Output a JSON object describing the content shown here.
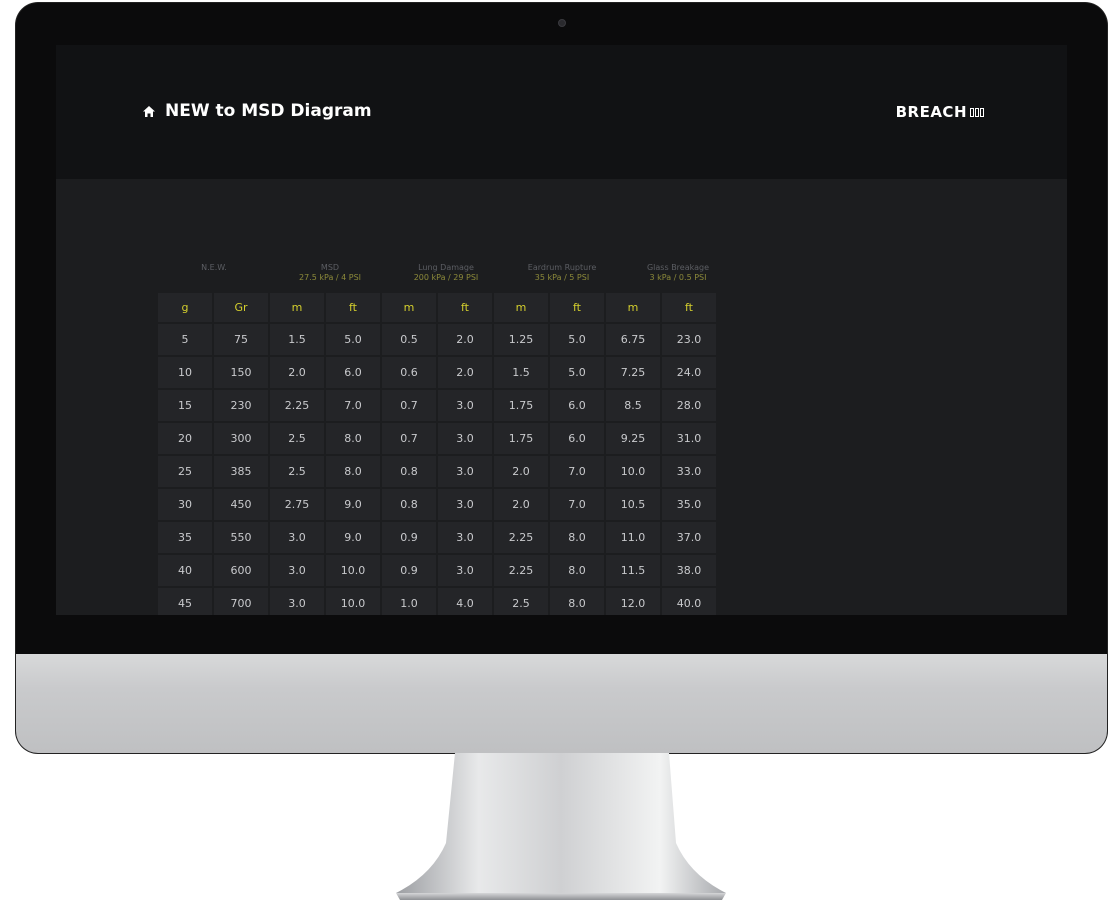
{
  "header": {
    "title": "NEW to MSD Diagram",
    "brand": "BREACH"
  },
  "groups": [
    {
      "label": "N.E.W.",
      "sub": ""
    },
    {
      "label": "MSD",
      "sub": "27.5 kPa / 4 PSI"
    },
    {
      "label": "Lung Damage",
      "sub": "200 kPa / 29 PSI"
    },
    {
      "label": "Eardrum Rupture",
      "sub": "35 kPa / 5 PSI"
    },
    {
      "label": "Glass Breakage",
      "sub": "3 kPa / 0.5 PSI"
    }
  ],
  "units": [
    "g",
    "Gr",
    "m",
    "ft",
    "m",
    "ft",
    "m",
    "ft",
    "m",
    "ft"
  ],
  "rows": [
    [
      "5",
      "75",
      "1.5",
      "5.0",
      "0.5",
      "2.0",
      "1.25",
      "5.0",
      "6.75",
      "23.0"
    ],
    [
      "10",
      "150",
      "2.0",
      "6.0",
      "0.6",
      "2.0",
      "1.5",
      "5.0",
      "7.25",
      "24.0"
    ],
    [
      "15",
      "230",
      "2.25",
      "7.0",
      "0.7",
      "3.0",
      "1.75",
      "6.0",
      "8.5",
      "28.0"
    ],
    [
      "20",
      "300",
      "2.5",
      "8.0",
      "0.7",
      "3.0",
      "1.75",
      "6.0",
      "9.25",
      "31.0"
    ],
    [
      "25",
      "385",
      "2.5",
      "8.0",
      "0.8",
      "3.0",
      "2.0",
      "7.0",
      "10.0",
      "33.0"
    ],
    [
      "30",
      "450",
      "2.75",
      "9.0",
      "0.8",
      "3.0",
      "2.0",
      "7.0",
      "10.5",
      "35.0"
    ],
    [
      "35",
      "550",
      "3.0",
      "9.0",
      "0.9",
      "3.0",
      "2.25",
      "8.0",
      "11.0",
      "37.0"
    ],
    [
      "40",
      "600",
      "3.0",
      "10.0",
      "0.9",
      "3.0",
      "2.25",
      "8.0",
      "11.5",
      "38.0"
    ],
    [
      "45",
      "700",
      "3.0",
      "10.0",
      "1.0",
      "4.0",
      "2.5",
      "8.0",
      "12.0",
      "40.0"
    ]
  ],
  "icons": {
    "home": "home-icon",
    "camera": "camera-icon"
  },
  "colors": {
    "accent": "#d4cf2d",
    "background": "#1c1d1f",
    "header": "#111214"
  }
}
